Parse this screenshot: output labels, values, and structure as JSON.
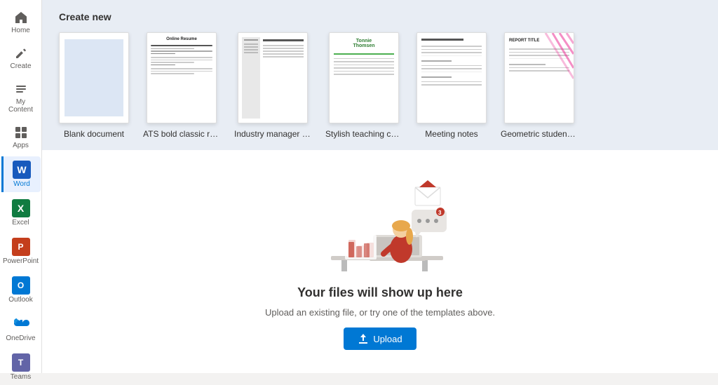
{
  "sidebar": {
    "items": [
      {
        "id": "home",
        "label": "Home",
        "icon": "home"
      },
      {
        "id": "create",
        "label": "Create",
        "icon": "create"
      },
      {
        "id": "my-content",
        "label": "My Content",
        "icon": "my-content"
      },
      {
        "id": "apps",
        "label": "Apps",
        "icon": "apps"
      },
      {
        "id": "word",
        "label": "Word",
        "icon": "W",
        "active": true
      },
      {
        "id": "excel",
        "label": "Excel",
        "icon": "X"
      },
      {
        "id": "powerpoint",
        "label": "PowerPoint",
        "icon": "P"
      },
      {
        "id": "outlook",
        "label": "Outlook",
        "icon": "O"
      },
      {
        "id": "onedrive",
        "label": "OneDrive",
        "icon": "cloud"
      },
      {
        "id": "teams",
        "label": "Teams",
        "icon": "T"
      }
    ]
  },
  "create_section": {
    "title": "Create new",
    "templates": [
      {
        "id": "blank",
        "label": "Blank document"
      },
      {
        "id": "ats-resume",
        "label": "ATS bold classic resu..."
      },
      {
        "id": "industry-manager",
        "label": "Industry manager re..."
      },
      {
        "id": "stylish-teaching",
        "label": "Stylish teaching cov..."
      },
      {
        "id": "meeting-notes",
        "label": "Meeting notes"
      },
      {
        "id": "geometric-student",
        "label": "Geometric student r..."
      }
    ]
  },
  "files_section": {
    "title": "Your files will show up here",
    "subtitle": "Upload an existing file, or try one of the templates above.",
    "upload_label": "Upload"
  }
}
